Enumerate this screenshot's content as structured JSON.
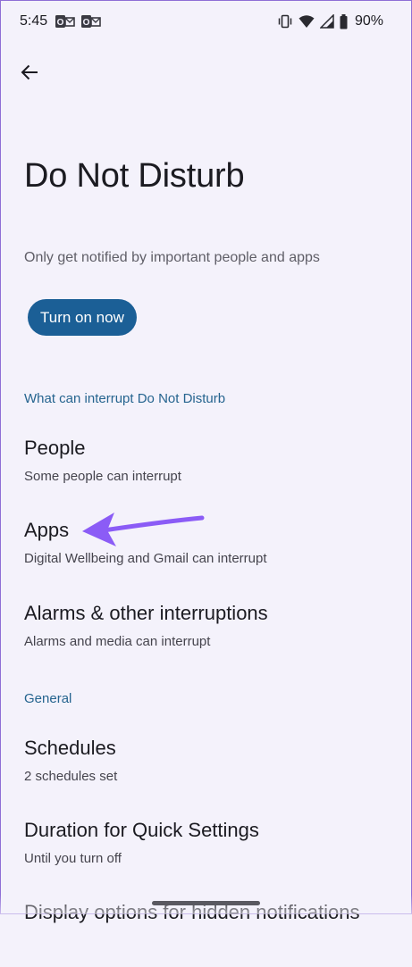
{
  "status_bar": {
    "time": "5:45",
    "battery": "90%",
    "notification_icons": [
      "outlook-icon",
      "outlook-icon"
    ],
    "system_icons": [
      "vibrate-icon",
      "wifi-icon",
      "signal-icon",
      "battery-icon"
    ]
  },
  "header": {
    "back_icon": "arrow-back-icon",
    "title": "Do Not Disturb",
    "subtitle": "Only get notified by important people and apps"
  },
  "turn_on_button": {
    "label": "Turn on now"
  },
  "sections": [
    {
      "header": "What can interrupt Do Not Disturb",
      "items": [
        {
          "title": "People",
          "summary": "Some people can interrupt"
        },
        {
          "title": "Apps",
          "summary": "Digital Wellbeing and Gmail can interrupt"
        },
        {
          "title": "Alarms & other interruptions",
          "summary": "Alarms and media can interrupt"
        }
      ]
    },
    {
      "header": "General",
      "items": [
        {
          "title": "Schedules",
          "summary": "2 schedules set"
        },
        {
          "title": "Duration for Quick Settings",
          "summary": "Until you turn off"
        },
        {
          "title": "Display options for hidden notifications",
          "summary": ""
        }
      ]
    }
  ],
  "colors": {
    "background": "#f4f2fb",
    "accent_button": "#1b5f96",
    "section_header": "#25648f",
    "annotation_arrow": "#8b5cf6"
  }
}
